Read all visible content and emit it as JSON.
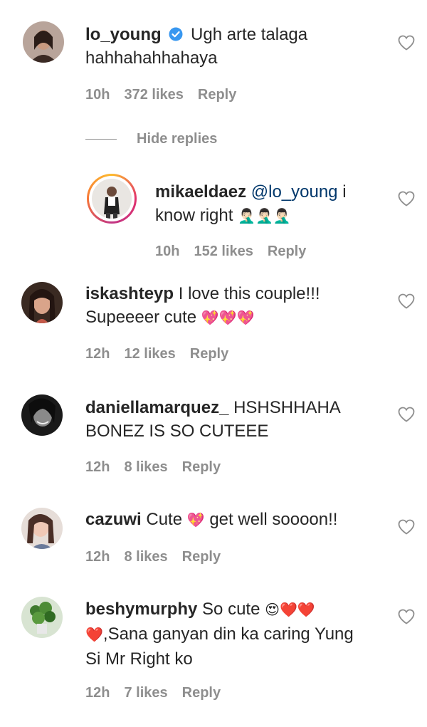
{
  "comments": [
    {
      "username": "lo_young",
      "verified": true,
      "text_line1": "Ugh arte talaga",
      "text_line2": "hahhahahhahaya",
      "time": "10h",
      "likes": "372 likes",
      "reply": "Reply",
      "hide_replies": "Hide replies"
    },
    {
      "username": "mikaeldaez",
      "mention": "@lo_young",
      "text_line1_tail": "i",
      "text_line2": "know right",
      "emoji": "🤦🏻‍♂️🤦🏻‍♂️🤦🏻‍♂️",
      "time": "10h",
      "likes": "152 likes",
      "reply": "Reply"
    },
    {
      "username": "iskashteyp",
      "text_line1": "I love this couple!!!",
      "text_line2": "Supeeeer cute",
      "emoji": "💖💖💖",
      "time": "12h",
      "likes": "12 likes",
      "reply": "Reply"
    },
    {
      "username": "daniellamarquez_",
      "text_line1": "HSHSHHAHA",
      "text_line2": "BONEZ IS SO CUTEEE",
      "time": "12h",
      "likes": "8 likes",
      "reply": "Reply"
    },
    {
      "username": "cazuwi",
      "text_pre": "Cute",
      "emoji": "💖",
      "text_post": "get well soooon!!",
      "time": "12h",
      "likes": "8 likes",
      "reply": "Reply"
    },
    {
      "username": "beshymurphy",
      "text_line1": "So cute",
      "emoji_line1": "😍❤️❤️",
      "emoji_line2": "❤️",
      "text_line2": ",Sana ganyan din ka caring Yung",
      "text_line3": "Si Mr Right ko",
      "time": "12h",
      "likes": "7 likes",
      "reply": "Reply"
    }
  ],
  "icons": {
    "like": "heart-outline-icon",
    "verified": "verified-badge-icon"
  },
  "colors": {
    "text": "#262626",
    "meta": "#8e8e8e",
    "mention": "#00376b",
    "verified": "#3897f0"
  }
}
